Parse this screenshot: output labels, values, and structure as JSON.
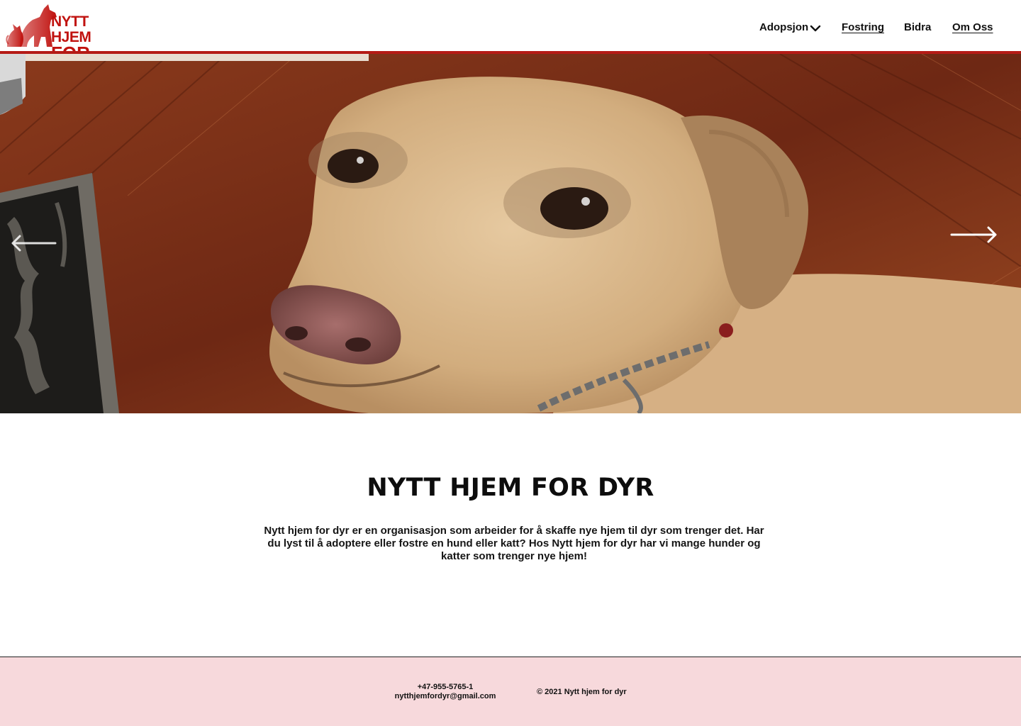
{
  "header": {
    "logo": {
      "line1": "NYTT HJEM",
      "line2": "FOR DYR",
      "icon": "dog-and-cat-silhouette-icon",
      "color": "#c0120f"
    },
    "nav": {
      "adopsjon": "Adopsjon",
      "fostring": "Fostring",
      "bidra": "Bidra",
      "om_oss": "Om Oss"
    },
    "accent_color": "#b51b16"
  },
  "hero": {
    "image": "dog-photo",
    "prev_icon": "arrow-left-icon",
    "next_icon": "arrow-right-icon"
  },
  "main": {
    "title": "NYTT HJEM FOR DYR",
    "intro": "Nytt hjem for dyr er en organisasjon som arbeider for å skaffe nye hjem til dyr som trenger det. Har du lyst til å adoptere eller fostre en hund eller katt? Hos Nytt hjem for dyr har vi mange hunder og katter som trenger nye hjem!"
  },
  "footer": {
    "phone": "+47-955-5765-1",
    "email": "nytthjemfordyr@gmail.com",
    "copyright": "© 2021 Nytt hjem for dyr",
    "background": "#f7d9dc"
  }
}
